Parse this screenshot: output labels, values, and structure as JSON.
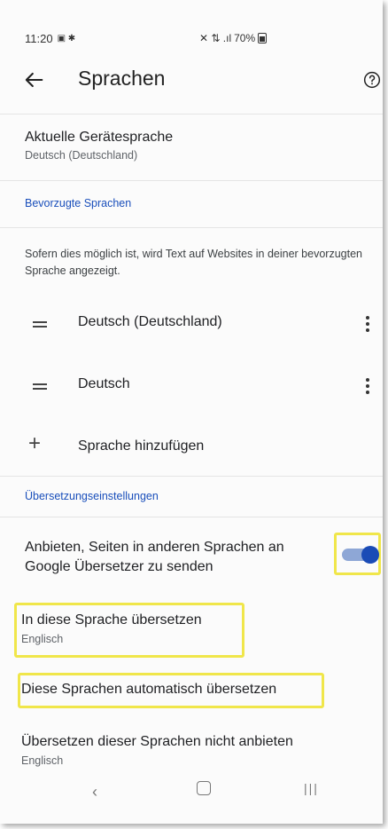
{
  "status_bar": {
    "time": "11:20",
    "left_icons": "▣ ✱",
    "right_icons": "✕ ⇅ .ıl",
    "battery": "70%"
  },
  "app_bar": {
    "title": "Sprachen",
    "back_icon": "arrow-back-icon",
    "help_icon": "help-circle-icon"
  },
  "device_language": {
    "title": "Aktuelle Gerätesprache",
    "value": "Deutsch (Deutschland)"
  },
  "preferred": {
    "header": "Bevorzugte Sprachen",
    "description": "Sofern dies möglich ist, wird Text auf Websites in deiner bevorzugten Sprache angezeigt.",
    "languages": [
      {
        "label": "Deutsch (Deutschland)"
      },
      {
        "label": "Deutsch"
      }
    ],
    "add_label": "Sprache hinzufügen"
  },
  "translation": {
    "header": "Übersetzungseinstellungen",
    "offer_label": "Anbieten, Seiten in anderen Sprachen an Google Übersetzer zu senden",
    "offer_enabled": true,
    "target_title": "In diese Sprache übersetzen",
    "target_value": "Englisch",
    "auto_title": "Diese Sprachen automatisch übersetzen",
    "never_title": "Übersetzen dieser Sprachen nicht anbieten",
    "never_value": "Englisch"
  },
  "colors": {
    "accent": "#1a4bb6",
    "highlight": "#f0e64a"
  }
}
